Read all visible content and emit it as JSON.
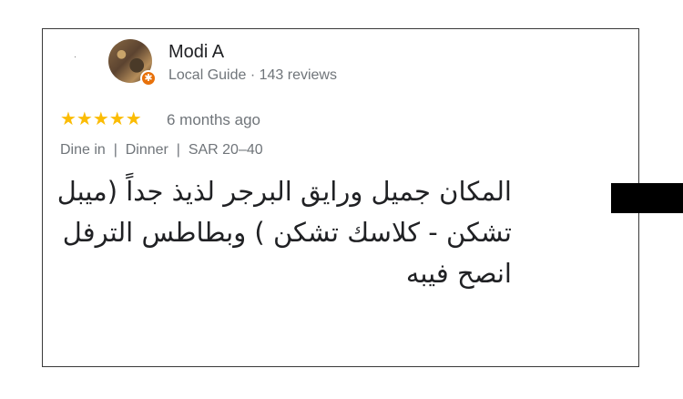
{
  "review_card": {
    "user": {
      "name": "Modi A",
      "meta": "Local Guide · 143 reviews",
      "badge_symbol": "✱"
    },
    "rating": {
      "stars": 5,
      "stars_text": "★★★★★",
      "time": "6 months ago"
    },
    "tags": "Dine in  |  Dinner  |  SAR 20–40",
    "review_text": "المكان جميل ورايق البرجر لذيذ جداً (ميبل تشكن - كلاسك تشكن ) وبطاطس الترفل انصح فيبه"
  },
  "colors": {
    "star": "#fbbc04",
    "badge": "#e8710a",
    "meta_text": "#70757a",
    "primary_text": "#202124",
    "redaction": "#000000"
  }
}
